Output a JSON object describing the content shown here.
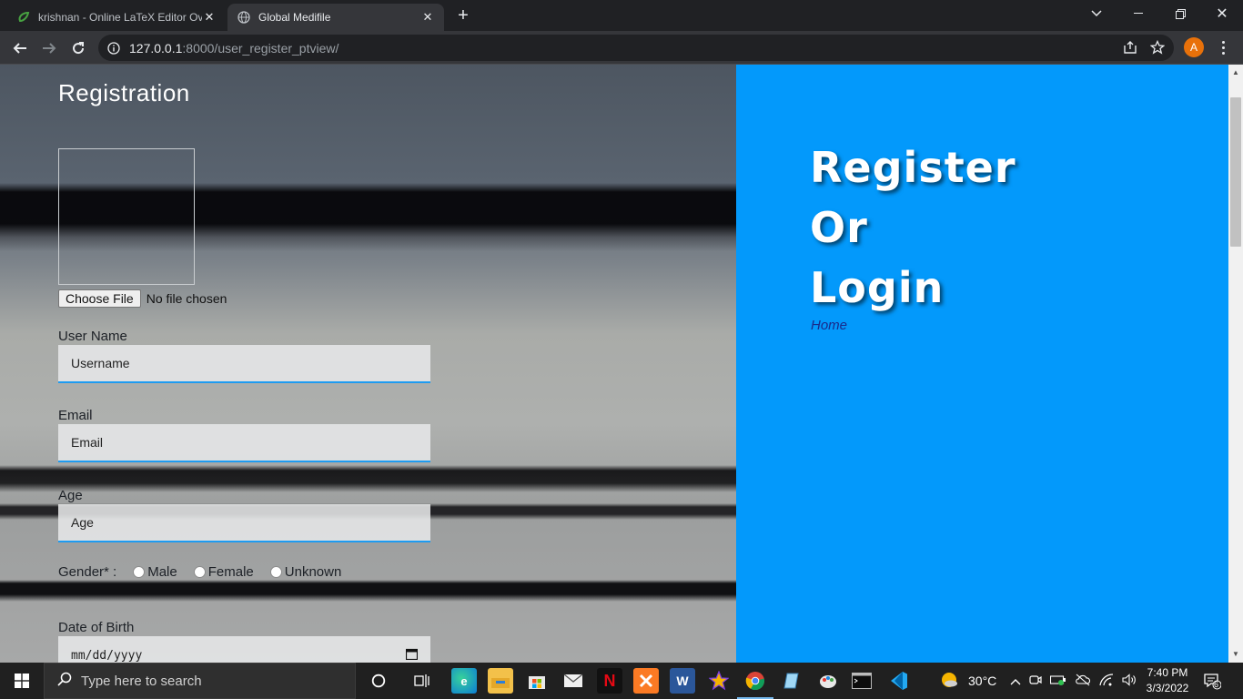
{
  "browser": {
    "tabs": [
      {
        "title": "krishnan - Online LaTeX Editor Ov",
        "active": false
      },
      {
        "title": "Global Medifile",
        "active": true
      }
    ],
    "url_host": "127.0.0.1",
    "url_path": ":8000/user_register_ptview/",
    "profile_initial": "A"
  },
  "page": {
    "registration_title": "Registration",
    "file": {
      "button": "Choose File",
      "status": "No file chosen"
    },
    "username": {
      "label": "User Name",
      "placeholder": "Username"
    },
    "email": {
      "label": "Email",
      "placeholder": "Email"
    },
    "age": {
      "label": "Age",
      "placeholder": "Age"
    },
    "gender": {
      "label": "Gender* :",
      "options": [
        "Male",
        "Female",
        "Unknown"
      ]
    },
    "dob": {
      "label": "Date of Birth",
      "placeholder": "mm/dd/yyyy"
    },
    "side_heading": [
      "Register",
      "Or",
      "Login"
    ],
    "home_link": "Home"
  },
  "taskbar": {
    "search_placeholder": "Type here to search",
    "temperature": "30°C",
    "time": "7:40 PM",
    "date": "3/3/2022",
    "notification_count": "6"
  },
  "colors": {
    "accent_blue": "#0399fb",
    "field_underline": "#1e9bf0"
  }
}
